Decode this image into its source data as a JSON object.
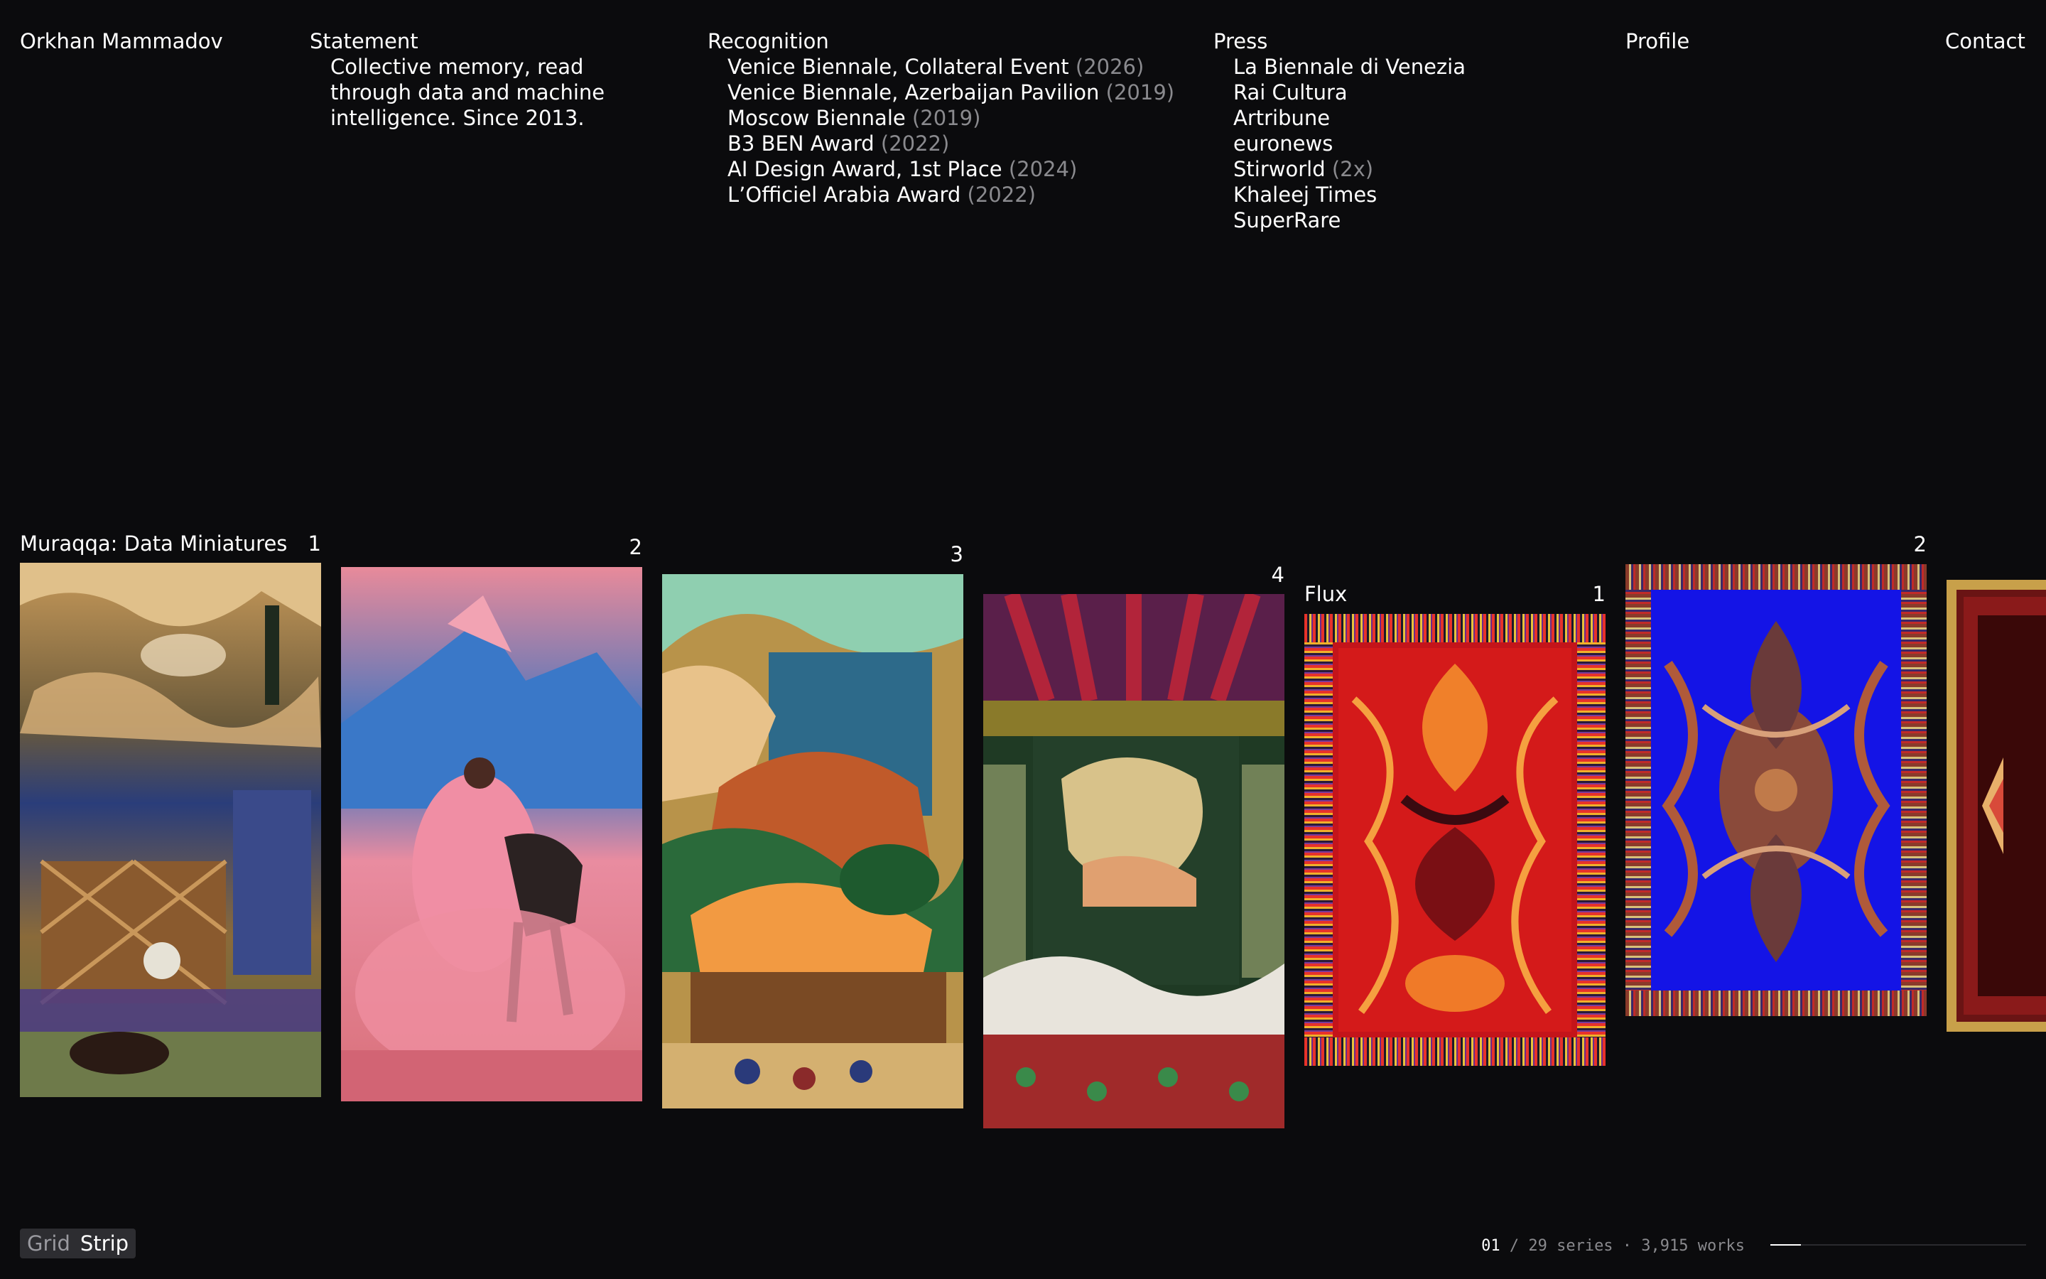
{
  "header": {
    "artist_name": "Orkhan Mammadov",
    "statement": {
      "title": "Statement",
      "text": "Collective memory, read through data and machine intelligence. Since 2013."
    },
    "recognition": {
      "title": "Recognition",
      "items": [
        {
          "name": "Venice Biennale, Collateral Event",
          "year": "(2026)"
        },
        {
          "name": "Venice Biennale, Azerbaijan Pavilion",
          "year": "(2019)"
        },
        {
          "name": "Moscow Biennale",
          "year": "(2019)"
        },
        {
          "name": "B3 BEN Award",
          "year": "(2022)"
        },
        {
          "name": "AI Design Award, 1st Place",
          "year": "(2024)"
        },
        {
          "name": "L’Officiel Arabia Award",
          "year": "(2022)"
        }
      ]
    },
    "press": {
      "title": "Press",
      "items": [
        {
          "name": "La Biennale di Venezia",
          "note": ""
        },
        {
          "name": "Rai Cultura",
          "note": ""
        },
        {
          "name": "Artribune",
          "note": ""
        },
        {
          "name": "euronews",
          "note": ""
        },
        {
          "name": "Stirworld",
          "note": "(2x)"
        },
        {
          "name": "Khaleej Times",
          "note": ""
        },
        {
          "name": "SuperRare",
          "note": ""
        }
      ]
    },
    "profile": "Profile",
    "contact": "Contact"
  },
  "strip": {
    "series": [
      {
        "title": "Muraqqa: Data Miniatures",
        "works": [
          "1",
          "2",
          "3",
          "4"
        ]
      },
      {
        "title": "Flux",
        "works": [
          "1",
          "2"
        ]
      }
    ]
  },
  "footer": {
    "view_toggle": {
      "grid": "Grid",
      "strip": "Strip",
      "active": "Strip"
    },
    "counter": {
      "current": "01",
      "rest": "/ 29 series · 3,915 works"
    },
    "progress_fraction": 0.12
  },
  "colors": {
    "background": "#0b0b0d",
    "text": "#ffffff",
    "muted": "#8a8a8e"
  }
}
